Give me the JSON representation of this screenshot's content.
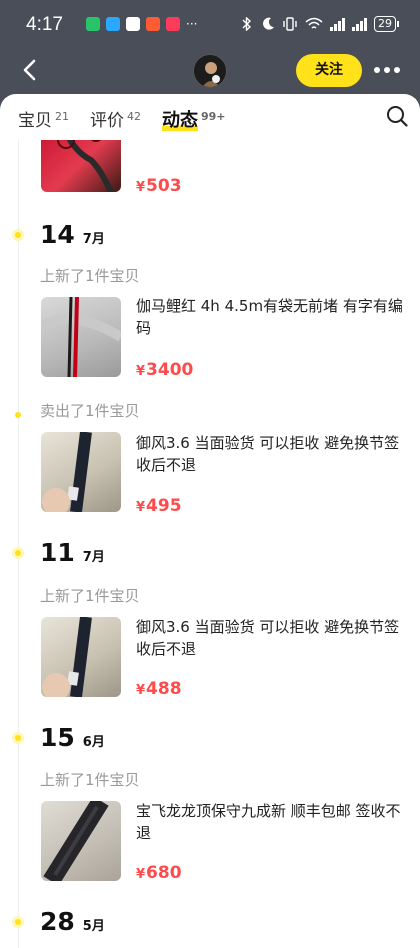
{
  "status_bar": {
    "time": "4:17",
    "more": "···",
    "battery": "29"
  },
  "header": {
    "follow_label": "关注"
  },
  "tabs": [
    {
      "label": "宝贝",
      "count": "21"
    },
    {
      "label": "评价",
      "count": "42"
    },
    {
      "label": "动态",
      "count": "99+"
    }
  ],
  "feed": {
    "top_item": {
      "price": "503"
    },
    "groups": [
      {
        "day": "14",
        "month": "7月",
        "entries": [
          {
            "event": "上新了1件宝贝",
            "title": "伽马鲤红 4h 4.5m有袋无前堵 有字有编码",
            "price": "3400"
          },
          {
            "event": "卖出了1件宝贝",
            "title": "御风3.6 当面验货 可以拒收 避免换节签收后不退",
            "price": "495"
          }
        ]
      },
      {
        "day": "11",
        "month": "7月",
        "entries": [
          {
            "event": "上新了1件宝贝",
            "title": "御风3.6 当面验货 可以拒收 避免换节签收后不退",
            "price": "488"
          }
        ]
      },
      {
        "day": "15",
        "month": "6月",
        "entries": [
          {
            "event": "上新了1件宝贝",
            "title": "宝飞龙龙顶保守九成新 顺丰包邮 签收不退",
            "price": "680"
          }
        ]
      },
      {
        "day": "28",
        "month": "5月",
        "entries": []
      }
    ]
  },
  "currency": "¥",
  "colors": {
    "accent_yellow": "#ffe21a",
    "price_red": "#ff4b4b",
    "header_bg": "#4a4e59"
  }
}
